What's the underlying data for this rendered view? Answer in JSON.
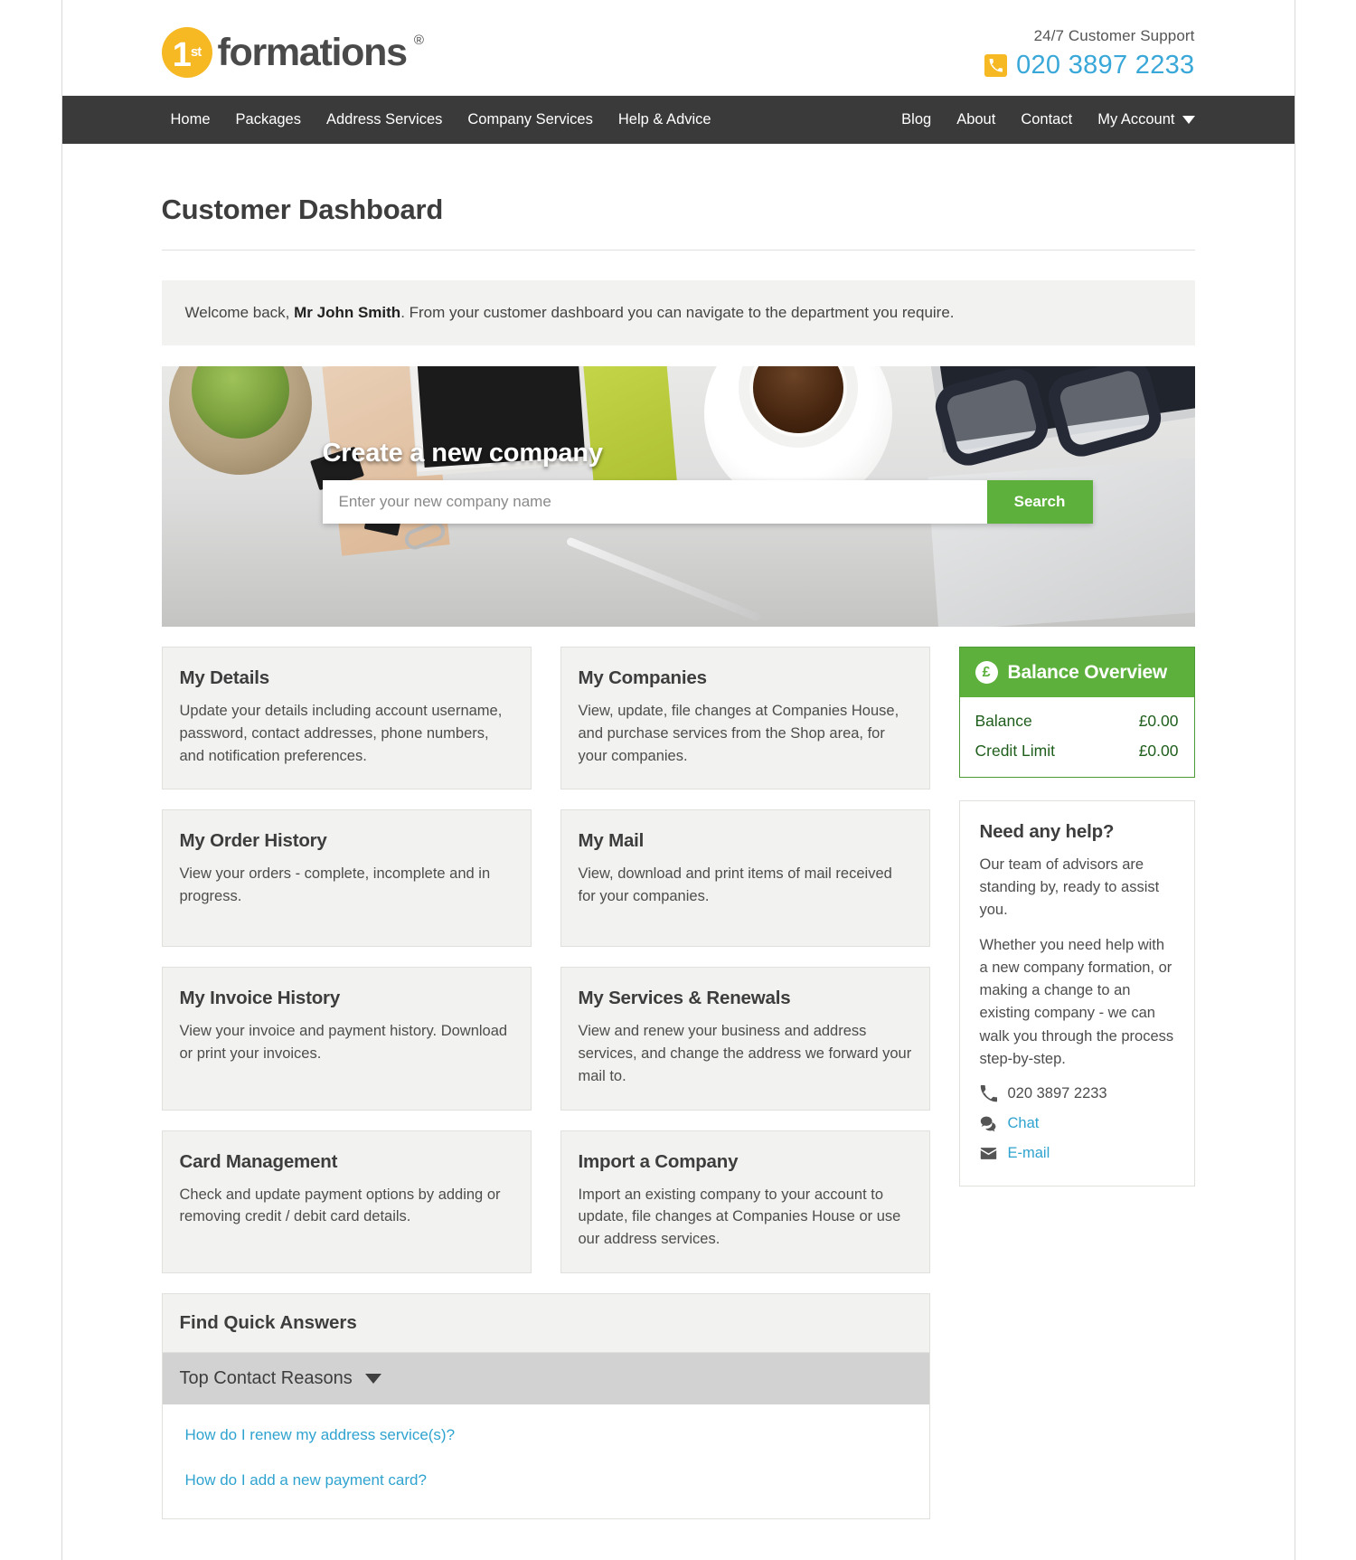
{
  "brand": {
    "logo_number": "1",
    "logo_sup": "st",
    "logo_word": "formations",
    "logo_reg": "®",
    "accent_yellow": "#f6b924",
    "accent_green": "#5cb03b",
    "accent_blue": "#2fa3cf",
    "nav_bg": "#3a3a3a"
  },
  "header": {
    "support_label": "24/7 Customer Support",
    "support_phone": "020 3897 2233",
    "phone_icon": "phone-icon"
  },
  "nav": {
    "left": [
      {
        "label": "Home"
      },
      {
        "label": "Packages"
      },
      {
        "label": "Address Services"
      },
      {
        "label": "Company Services"
      },
      {
        "label": "Help & Advice"
      }
    ],
    "right": [
      {
        "label": "Blog"
      },
      {
        "label": "About"
      },
      {
        "label": "Contact"
      },
      {
        "label": "My Account"
      }
    ],
    "account_caret_icon": "chevron-down-icon"
  },
  "page": {
    "title": "Customer Dashboard",
    "welcome_prefix": "Welcome back, ",
    "welcome_name": "Mr John Smith",
    "welcome_suffix": ". From your customer dashboard you can navigate to the department you require."
  },
  "hero": {
    "title": "Create a new company",
    "search_placeholder": "Enter your new company name",
    "search_value": "",
    "search_button": "Search"
  },
  "tiles": [
    {
      "title": "My Details",
      "text": "Update your details including account username, password, contact addresses, phone numbers, and notification preferences."
    },
    {
      "title": "My Companies",
      "text": "View, update, file changes at Companies House, and purchase services from the Shop area, for your companies."
    },
    {
      "title": "My Order History",
      "text": "View your orders - complete, incomplete and in progress."
    },
    {
      "title": "My Mail",
      "text": "View, download and print items of mail received for your companies."
    },
    {
      "title": "My Invoice History",
      "text": "View your invoice and payment history. Download or print your invoices."
    },
    {
      "title": "My Services & Renewals",
      "text": "View and renew your business and address services, and change the address we forward your mail to."
    },
    {
      "title": "Card Management",
      "text": "Check and update payment options by adding or removing credit / debit card details."
    },
    {
      "title": "Import a Company",
      "text": "Import an existing company to your account to update, file changes at Companies House or use our address services."
    }
  ],
  "quick_answers": {
    "heading": "Find Quick Answers",
    "toggle_label": "Top Contact Reasons",
    "toggle_icon": "chevron-down-icon",
    "links": [
      {
        "label": "How do I renew my address service(s)?"
      },
      {
        "label": "How do I add a new payment card?"
      }
    ]
  },
  "balance": {
    "icon": "pound-sterling-icon",
    "icon_glyph": "£",
    "heading": "Balance Overview",
    "rows": [
      {
        "label": "Balance",
        "value": "£0.00"
      },
      {
        "label": "Credit Limit",
        "value": "£0.00"
      }
    ]
  },
  "help": {
    "heading": "Need any help?",
    "paragraph1": "Our team of advisors are standing by, ready to assist you.",
    "paragraph2": "Whether you need help with a new company formation, or making a change to an existing company - we can walk you through the process step-by-step.",
    "phone": "020 3897 2233",
    "phone_icon": "phone-icon",
    "chat_label": "Chat",
    "chat_icon": "chat-bubbles-icon",
    "email_label": "E-mail",
    "email_icon": "envelope-icon"
  }
}
